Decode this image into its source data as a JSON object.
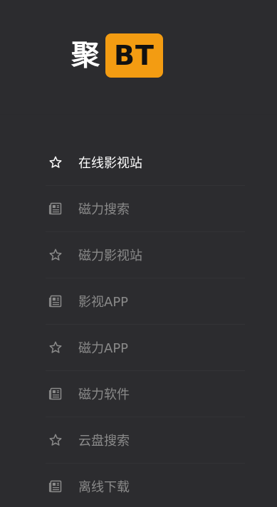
{
  "logo": {
    "text": "聚",
    "badge": "BT",
    "badge_color": "#f39c12"
  },
  "colors": {
    "background": "#2c2c2f",
    "active_text": "#ffffff",
    "inactive_text": "#8a8a8a"
  },
  "nav": {
    "items": [
      {
        "label": "在线影视站",
        "icon": "star-outline-icon",
        "active": true
      },
      {
        "label": "磁力搜索",
        "icon": "newspaper-icon",
        "active": false
      },
      {
        "label": "磁力影视站",
        "icon": "star-outline-icon",
        "active": false
      },
      {
        "label": "影视APP",
        "icon": "newspaper-icon",
        "active": false
      },
      {
        "label": "磁力APP",
        "icon": "star-outline-icon",
        "active": false
      },
      {
        "label": "磁力软件",
        "icon": "newspaper-icon",
        "active": false
      },
      {
        "label": "云盘搜索",
        "icon": "star-outline-icon",
        "active": false
      },
      {
        "label": "离线下载",
        "icon": "newspaper-icon",
        "active": false
      }
    ]
  }
}
